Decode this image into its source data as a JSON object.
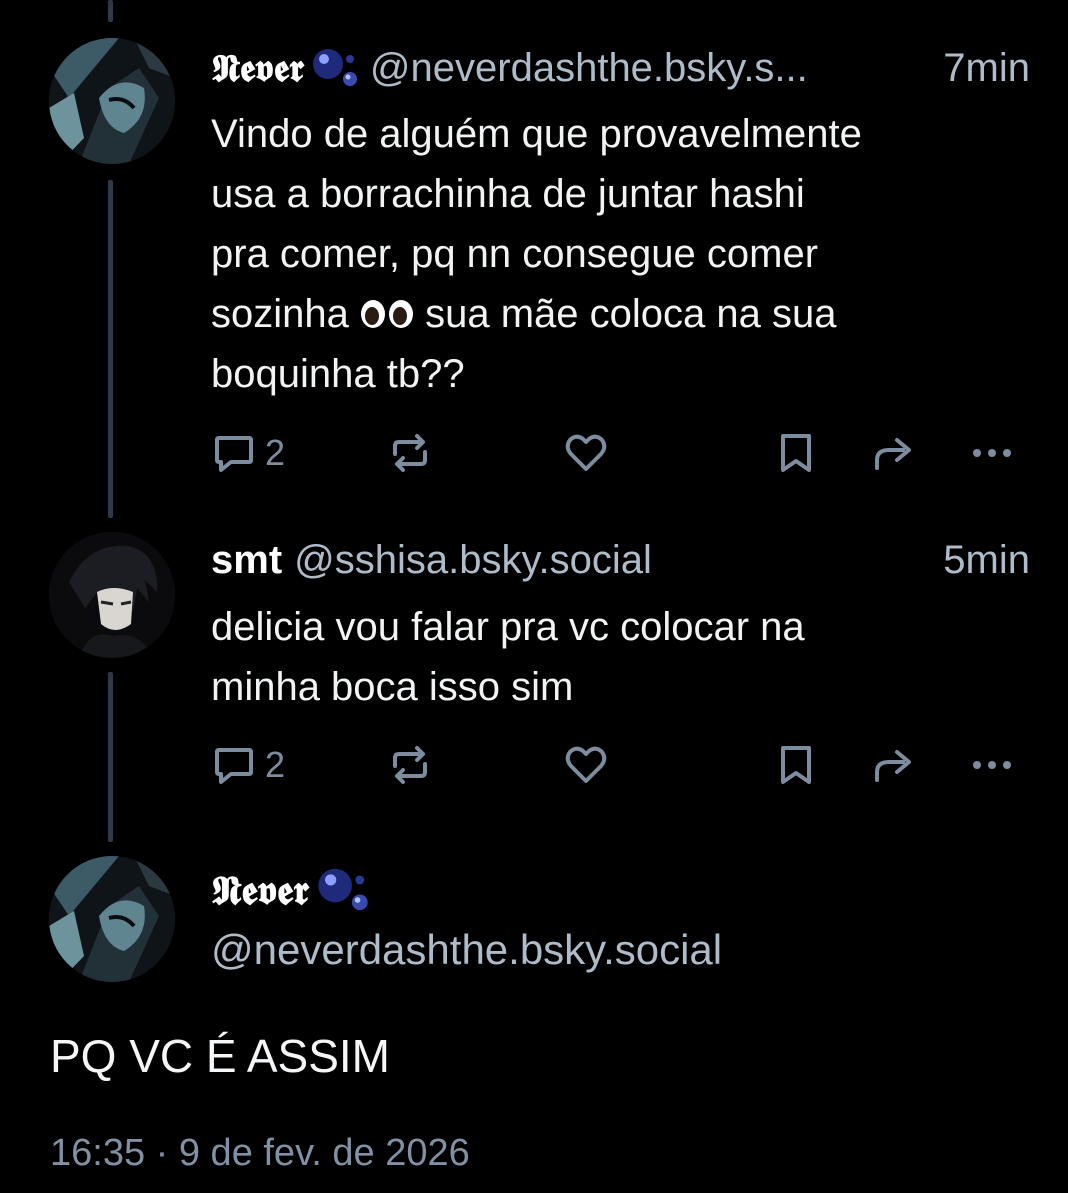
{
  "thread": [
    {
      "display_name": "𝕹𝖊𝖛𝖊𝖗",
      "handle": "@neverdashthe.bsky.s...",
      "time": "7min",
      "text_before_emoji": "Vindo de alguém que provavelmente\nusa a borrachinha de juntar hashi\npra comer, pq nn consegue comer\nsozinha ",
      "emoji": "eyes-emoji",
      "text_after_emoji": " sua mãe coloca na sua\nboquinha tb??",
      "reply_count": "2"
    },
    {
      "display_name": "smt",
      "handle": "@sshisa.bsky.social",
      "time": "5min",
      "text": "delicia vou falar pra vc colocar na\nminha boca isso sim",
      "reply_count": "2"
    }
  ],
  "main_post": {
    "display_name": "𝕹𝖊𝖛𝖊𝖗",
    "handle": "@neverdashthe.bsky.social",
    "text": "PQ VC É ASSIM",
    "timestamp": "16:35 · 9 de fev. de 2026"
  },
  "icons": {
    "reply": "speech-bubble-icon",
    "repost": "repost-arrows-icon",
    "like": "heart-icon",
    "bookmark": "bookmark-icon",
    "share": "share-arrow-icon",
    "more": "ellipsis-icon"
  },
  "colors": {
    "background": "#000000",
    "text": "#f1f3f5",
    "muted": "#aebbc9",
    "icon": "#7c8da0",
    "thread_line": "#2f3a48"
  }
}
